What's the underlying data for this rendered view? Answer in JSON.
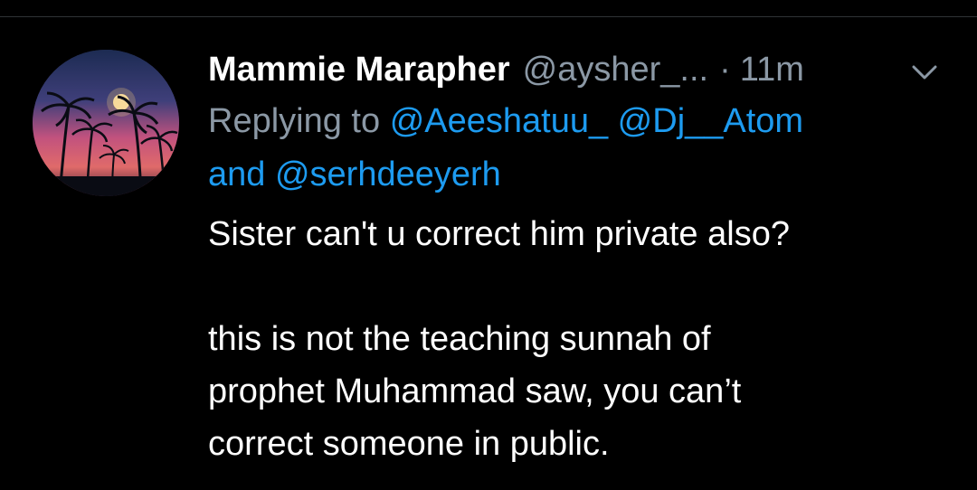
{
  "tweet": {
    "author": {
      "display_name": "Mammie Marapher",
      "handle": "@aysher_...",
      "avatar_icon": "palm-trees-sunset-avatar"
    },
    "separator": "·",
    "timestamp": "11m",
    "menu_icon": "chevron-down-icon",
    "replying_to": {
      "prefix": "Replying to",
      "mentions": [
        "@Aeeshatuu_",
        "@Dj__Atom",
        "@serhdeeyerh"
      ],
      "conjunction": "and"
    },
    "text": {
      "paragraph1": "Sister can't u correct him private also?",
      "paragraph2_line1": "this is not the teaching sunnah of",
      "paragraph2_line2": "prophet Muhammad saw, you can’t",
      "paragraph2_line3": "correct someone in public."
    }
  },
  "colors": {
    "background": "#000000",
    "text": "#ffffff",
    "secondary": "#8b98a5",
    "link": "#1d9bf0"
  }
}
